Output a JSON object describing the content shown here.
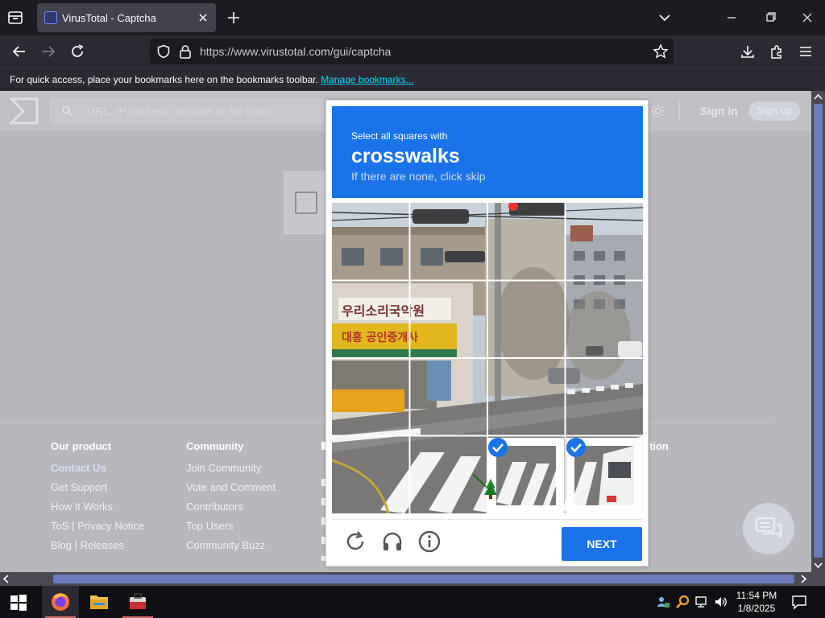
{
  "browser": {
    "tab_title": "VirusTotal - Captcha",
    "url": "https://www.virustotal.com/gui/captcha",
    "bookmarks_message": "For quick access, place your bookmarks here on the bookmarks toolbar.",
    "bookmarks_link": "Manage bookmarks..."
  },
  "page": {
    "search_placeholder": "URL, IP address, domain or file hash",
    "sign_in": "Sign in",
    "sign_up": "Sign up",
    "footer": {
      "columns": [
        {
          "heading": "Our product",
          "items": [
            "Contact Us",
            "Get Support",
            "How It Works",
            "ToS | Privacy Notice",
            "Blog | Releases"
          ]
        },
        {
          "heading": "Community",
          "items": [
            "Join Community",
            "Vote and Comment",
            "Contributors",
            "Top Users",
            "Community Buzz"
          ]
        }
      ],
      "partial_heading_right": "tion"
    }
  },
  "captcha": {
    "instruction_line1": "Select all squares with",
    "target_object": "crosswalks",
    "instruction_line3": "If there are none, click skip",
    "grid_rows": 4,
    "grid_cols": 4,
    "selected_tiles": [
      14,
      15
    ],
    "next_label": "NEXT",
    "icons": [
      "reload-icon",
      "audio-challenge-icon",
      "info-icon"
    ]
  },
  "taskbar": {
    "time": "11:54 PM",
    "date": "1/8/2025"
  },
  "colors": {
    "captcha_blue": "#1a73e8",
    "page_dim": "#b7b7bd",
    "browser_dark": "#1c1b22"
  }
}
